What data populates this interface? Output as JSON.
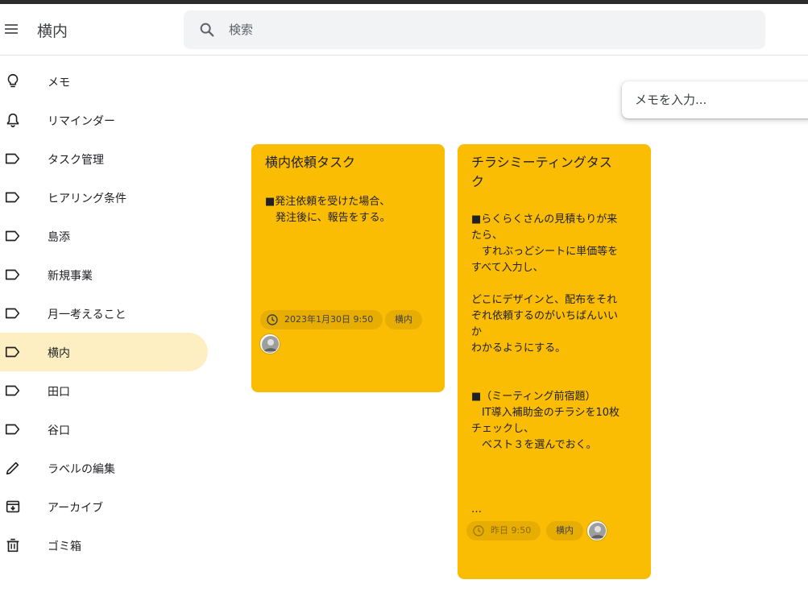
{
  "header": {
    "title": "横内",
    "search_placeholder": "検索"
  },
  "sidebar": {
    "items": [
      {
        "label": "メモ",
        "icon": "lightbulb-icon"
      },
      {
        "label": "リマインダー",
        "icon": "bell-icon"
      },
      {
        "label": "タスク管理",
        "icon": "label-icon"
      },
      {
        "label": "ヒアリング条件",
        "icon": "label-icon"
      },
      {
        "label": "島添",
        "icon": "label-icon"
      },
      {
        "label": "新規事業",
        "icon": "label-icon"
      },
      {
        "label": "月一考えること",
        "icon": "label-icon"
      },
      {
        "label": "横内",
        "icon": "label-icon",
        "active": true
      },
      {
        "label": "田口",
        "icon": "label-icon"
      },
      {
        "label": "谷口",
        "icon": "label-icon"
      },
      {
        "label": "ラベルの編集",
        "icon": "pencil-icon"
      },
      {
        "label": "アーカイブ",
        "icon": "archive-icon"
      },
      {
        "label": "ゴミ箱",
        "icon": "trash-icon"
      }
    ]
  },
  "take_note": {
    "placeholder": "メモを入力..."
  },
  "notes": [
    {
      "title": "横内依頼タスク",
      "body": "■発注依頼を受けた場合、\n　発注後に、報告をする。",
      "reminder": "2023年1月30日 9:50",
      "label": "横内"
    },
    {
      "title_line1": "チラシミーティングタス",
      "title_line2": "ク",
      "body": "■らくらくさんの見積もりが来\nたら、\n　すれぶっどシートに単価等を\nすべて入力し、\n\nどこにデザインと、配布をそれ\nぞれ依頼するのがいちばんいい\nか\nわかるようにする。\n\n\n■（ミーティング前宿題）\n　IT導入補助金のチラシを10枚\nチェックし、\n　ベスト３を選んでおく。\n\n\n\n…",
      "reminder": "昨日 9:50",
      "label": "横内"
    }
  ],
  "colors": {
    "note_yellow": "#fbbc04",
    "active_nav": "#feefc3",
    "search_bg": "#f1f3f4"
  }
}
